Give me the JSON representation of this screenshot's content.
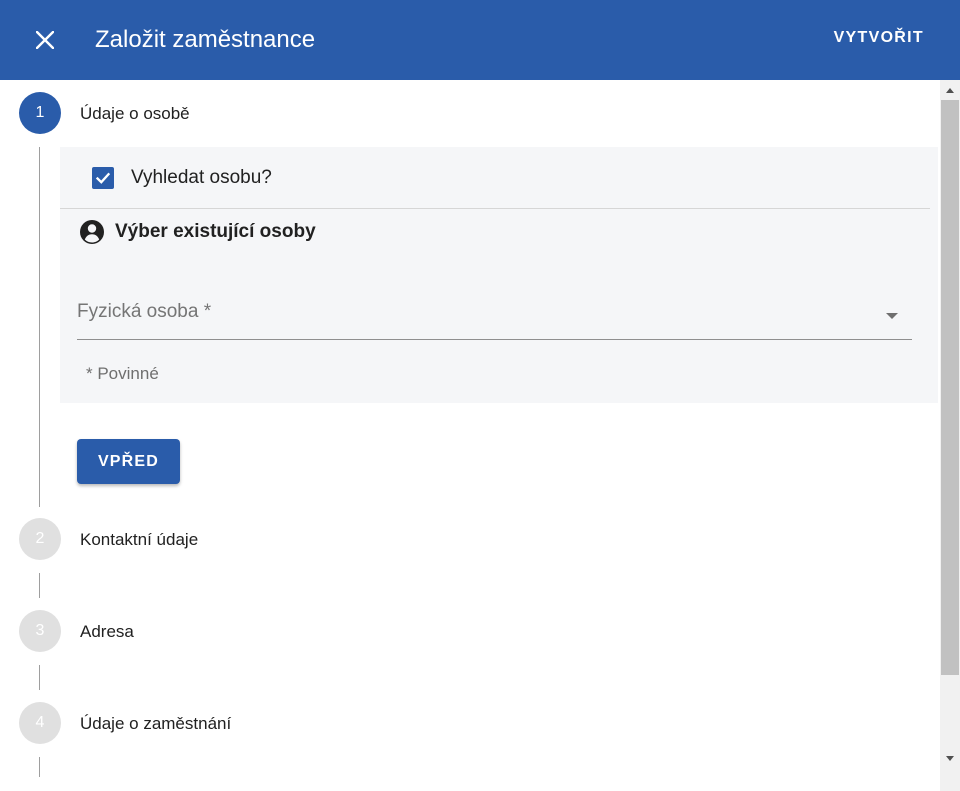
{
  "header": {
    "close_icon": "close-icon",
    "title": "Založit zaměstnance",
    "create_label": "VYTVOŘIT",
    "color": "#2a5caa"
  },
  "stepper": {
    "steps": [
      {
        "number": "1",
        "label": "Údaje o osobě",
        "state": "active"
      },
      {
        "number": "2",
        "label": "Kontaktní údaje",
        "state": "inactive"
      },
      {
        "number": "3",
        "label": "Adresa",
        "state": "inactive"
      },
      {
        "number": "4",
        "label": "Údaje o zaměstnání",
        "state": "inactive"
      }
    ]
  },
  "step1": {
    "search_person_checkbox": {
      "label": "Vyhledat osobu?",
      "checked": true
    },
    "section_icon": "account-circle-icon",
    "section_title": "Výber existující osoby",
    "person_select": {
      "placeholder": "Fyzická osoba *",
      "value": ""
    },
    "required_note": "* Povinné",
    "next_label": "VPŘED"
  }
}
